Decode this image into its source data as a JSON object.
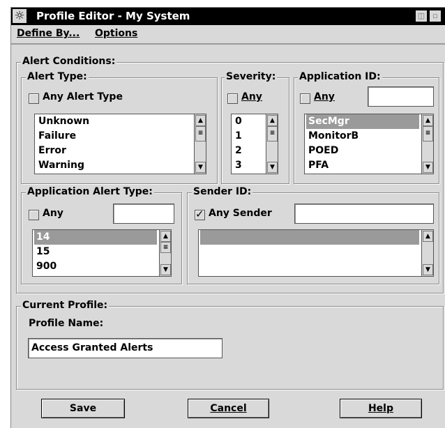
{
  "window": {
    "title": "Profile Editor  - My System"
  },
  "menu": {
    "define_by": "Define By...",
    "options": "Options"
  },
  "alert_conditions": {
    "legend": "Alert Conditions:",
    "alert_type": {
      "legend": "Alert Type:",
      "any_checked": false,
      "any_label": "Any Alert Type",
      "items": [
        "Unknown",
        "Failure",
        "Error",
        "Warning"
      ]
    },
    "severity": {
      "legend": "Severity:",
      "any_checked": false,
      "any_label": "Any",
      "items": [
        "0",
        "1",
        "2",
        "3"
      ]
    },
    "application_id": {
      "legend": "Application ID:",
      "any_checked": false,
      "any_label": "Any",
      "value": "",
      "items": [
        "SecMgr",
        "MonitorB",
        "POED",
        "PFA"
      ],
      "selected": "SecMgr"
    },
    "application_alert_type": {
      "legend": "Application Alert Type:",
      "any_checked": false,
      "any_label": "Any",
      "value": "",
      "items": [
        "14",
        "15",
        "900"
      ],
      "selected": "14"
    },
    "sender_id": {
      "legend": "Sender ID:",
      "any_checked": true,
      "any_label": "Any Sender",
      "value": "",
      "items": [
        ""
      ],
      "selected": ""
    }
  },
  "current_profile": {
    "legend": "Current Profile:",
    "name_label": "Profile Name:",
    "name_value": "Access Granted Alerts"
  },
  "buttons": {
    "save": "Save",
    "cancel": "Cancel",
    "help": "Help"
  }
}
